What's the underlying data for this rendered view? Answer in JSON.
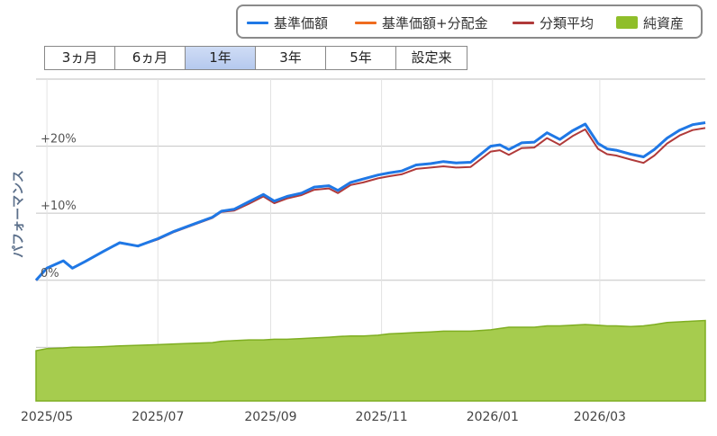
{
  "legend": [
    {
      "label": "基準価額",
      "color": "#1f78e6",
      "kind": "line"
    },
    {
      "label": "基準価額+分配金",
      "color": "#ef6c1f",
      "kind": "line"
    },
    {
      "label": "分類平均",
      "color": "#b03a3a",
      "kind": "line"
    },
    {
      "label": "純資産",
      "color": "#8fbe2a",
      "kind": "area"
    }
  ],
  "tabs": [
    {
      "label": "3ヵ月",
      "active": false
    },
    {
      "label": "6ヵ月",
      "active": false
    },
    {
      "label": "1年",
      "active": true
    },
    {
      "label": "3年",
      "active": false
    },
    {
      "label": "5年",
      "active": false
    },
    {
      "label": "設定来",
      "active": false
    }
  ],
  "chart_data": {
    "type": "line",
    "ylabel": "パフォーマンス",
    "yticks": [
      "+20%",
      "+10%",
      "0%"
    ],
    "ytick_values": [
      20,
      10,
      0
    ],
    "ylim": [
      -18,
      30
    ],
    "xlim": [
      "2025-04-25",
      "2026-04-28"
    ],
    "xticks": [
      {
        "label": "2025/05",
        "date": "2025-05-01"
      },
      {
        "label": "2025/07",
        "date": "2025-07-01"
      },
      {
        "label": "2025/09",
        "date": "2025-09-01"
      },
      {
        "label": "2025/11",
        "date": "2025-11-01"
      },
      {
        "label": "2026/01",
        "date": "2026-01-01"
      },
      {
        "label": "2026/03",
        "date": "2026-03-01"
      }
    ],
    "grid": true,
    "legend_position": "top-right",
    "x": [
      "2025-04-25",
      "2025-05-01",
      "2025-05-10",
      "2025-05-15",
      "2025-05-22",
      "2025-06-01",
      "2025-06-10",
      "2025-06-20",
      "2025-07-01",
      "2025-07-10",
      "2025-07-20",
      "2025-07-31",
      "2025-08-05",
      "2025-08-12",
      "2025-08-20",
      "2025-08-28",
      "2025-09-03",
      "2025-09-10",
      "2025-09-18",
      "2025-09-25",
      "2025-10-03",
      "2025-10-08",
      "2025-10-15",
      "2025-10-22",
      "2025-10-30",
      "2025-11-05",
      "2025-11-12",
      "2025-11-20",
      "2025-11-28",
      "2025-12-05",
      "2025-12-12",
      "2025-12-20",
      "2025-12-31",
      "2026-01-05",
      "2026-01-10",
      "2026-01-17",
      "2026-01-24",
      "2026-01-31",
      "2026-02-07",
      "2026-02-14",
      "2026-02-21",
      "2026-02-28",
      "2026-03-05",
      "2026-03-10",
      "2026-03-18",
      "2026-03-25",
      "2026-03-31",
      "2026-04-07",
      "2026-04-14",
      "2026-04-21",
      "2026-04-28"
    ],
    "series": [
      {
        "name": "基準価額",
        "values": [
          0.0,
          1.8,
          2.9,
          1.8,
          2.8,
          4.3,
          5.6,
          5.1,
          6.2,
          7.3,
          8.3,
          9.4,
          10.3,
          10.6,
          11.7,
          12.8,
          11.8,
          12.5,
          13.0,
          13.9,
          14.1,
          13.4,
          14.6,
          15.1,
          15.7,
          16.0,
          16.3,
          17.2,
          17.4,
          17.7,
          17.5,
          17.6,
          20.0,
          20.2,
          19.5,
          20.5,
          20.6,
          22.0,
          21.0,
          22.3,
          23.3,
          20.4,
          19.6,
          19.4,
          18.8,
          18.4,
          19.5,
          21.2,
          22.4,
          23.2,
          23.5
        ]
      },
      {
        "name": "基準価額+分配金",
        "values": [
          0.0,
          1.8,
          2.9,
          1.8,
          2.8,
          4.3,
          5.6,
          5.1,
          6.2,
          7.3,
          8.3,
          9.4,
          10.3,
          10.6,
          11.7,
          12.8,
          11.8,
          12.5,
          13.0,
          13.9,
          14.1,
          13.4,
          14.6,
          15.1,
          15.7,
          16.0,
          16.3,
          17.2,
          17.4,
          17.7,
          17.5,
          17.6,
          20.0,
          20.2,
          19.5,
          20.5,
          20.6,
          22.0,
          21.0,
          22.3,
          23.3,
          20.4,
          19.6,
          19.4,
          18.8,
          18.4,
          19.5,
          21.2,
          22.4,
          23.2,
          23.5
        ]
      },
      {
        "name": "分類平均",
        "values": [
          0.0,
          1.8,
          2.9,
          1.8,
          2.8,
          4.3,
          5.6,
          5.1,
          6.1,
          7.2,
          8.2,
          9.3,
          10.2,
          10.4,
          11.4,
          12.5,
          11.5,
          12.2,
          12.7,
          13.5,
          13.7,
          13.0,
          14.2,
          14.6,
          15.2,
          15.5,
          15.8,
          16.6,
          16.8,
          17.0,
          16.8,
          16.9,
          19.2,
          19.4,
          18.7,
          19.7,
          19.8,
          21.2,
          20.2,
          21.5,
          22.5,
          19.6,
          18.8,
          18.6,
          18.0,
          17.5,
          18.6,
          20.4,
          21.6,
          22.4,
          22.7
        ]
      },
      {
        "name": "純資産",
        "values": [
          -10.5,
          -10.2,
          -10.1,
          -10.0,
          -10.0,
          -9.9,
          -9.8,
          -9.7,
          -9.6,
          -9.5,
          -9.4,
          -9.3,
          -9.1,
          -9.0,
          -8.9,
          -8.9,
          -8.8,
          -8.8,
          -8.7,
          -8.6,
          -8.5,
          -8.4,
          -8.3,
          -8.3,
          -8.2,
          -8.0,
          -7.9,
          -7.8,
          -7.7,
          -7.6,
          -7.6,
          -7.6,
          -7.4,
          -7.2,
          -7.0,
          -7.0,
          -7.0,
          -6.8,
          -6.8,
          -6.7,
          -6.6,
          -6.7,
          -6.8,
          -6.8,
          -6.9,
          -6.8,
          -6.6,
          -6.3,
          -6.2,
          -6.1,
          -6.0
        ]
      }
    ]
  }
}
